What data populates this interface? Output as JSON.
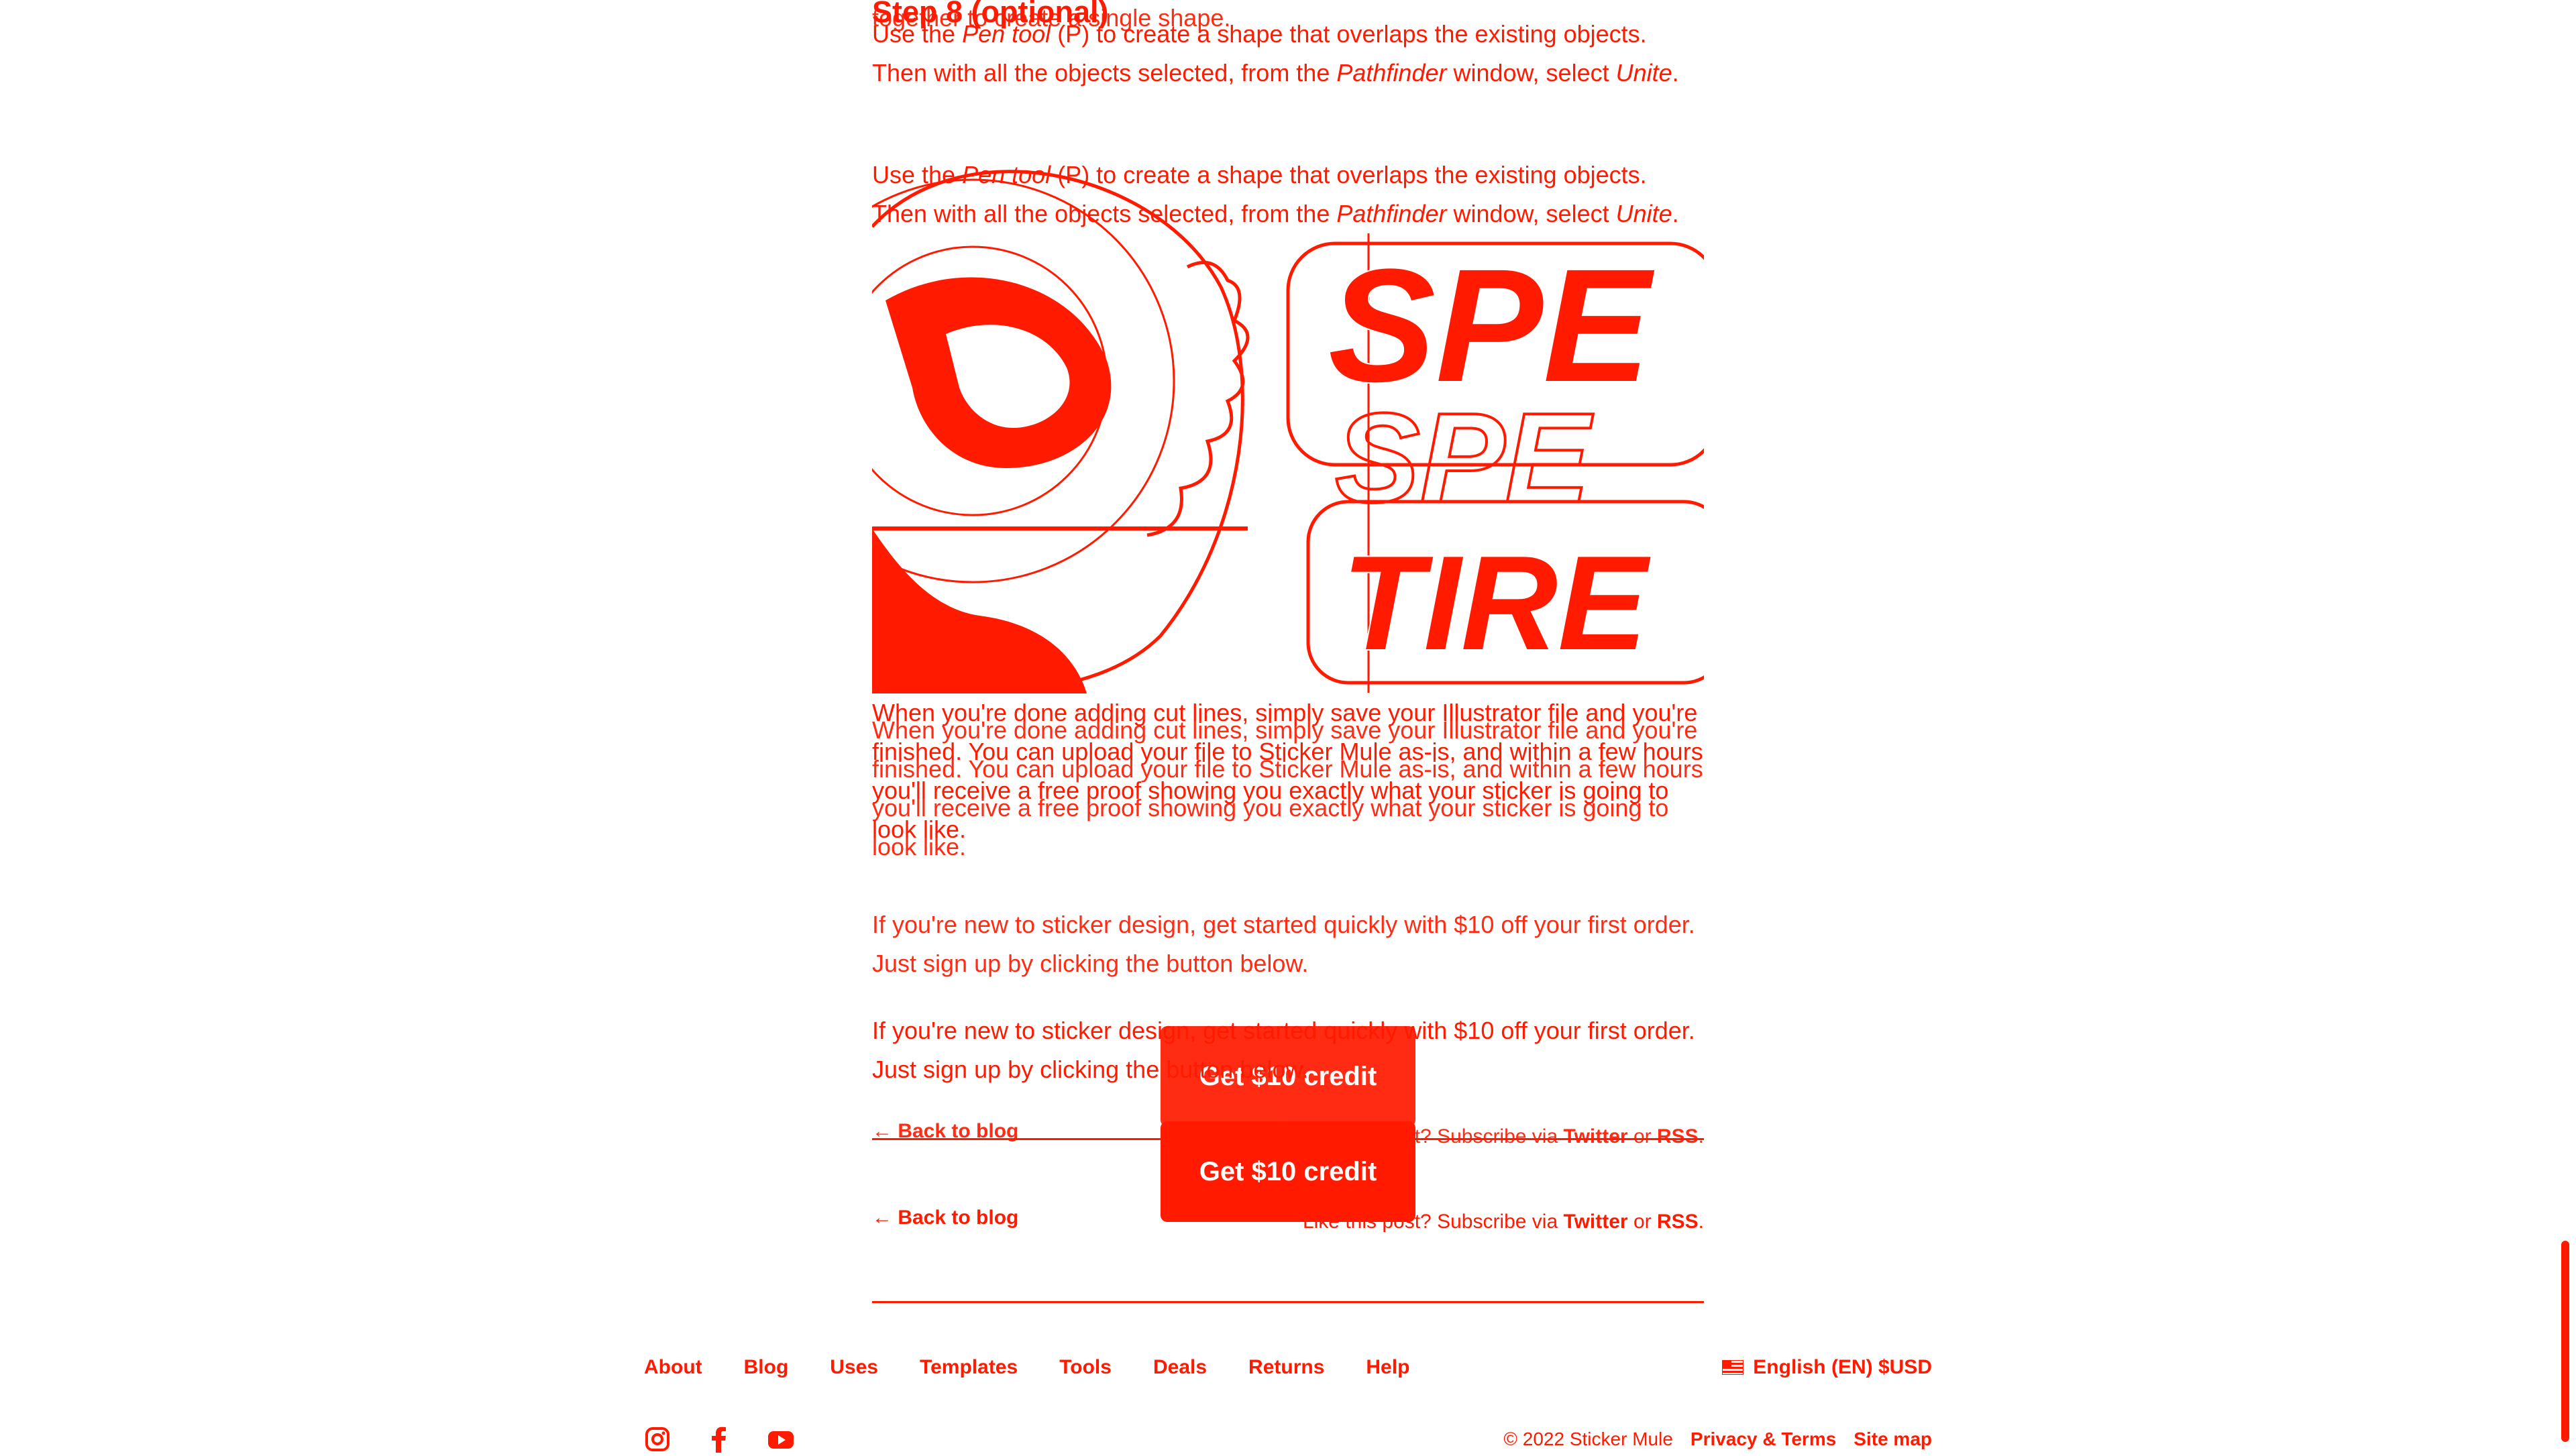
{
  "article": {
    "step_heading": "Step 8 (optional)",
    "pen_para": {
      "a": "Use the ",
      "pen_tool": "Pen tool",
      "b": " (P) to create a shape that overlaps the existing objects. Then with all the objects selected, from the ",
      "pathfinder": "Pathfinder",
      "c": " window, select ",
      "unite": "Unite",
      "d": "."
    },
    "ghost_para": "If you end up with two or more cut line objects, you'll need to bridge them together to create a single shape.",
    "done_para": "When you're done adding cut lines, simply save your Illustrator file and you're finished. You can upload your file to Sticker Mule as-is, and within a few hours you'll receive a free proof showing you exactly what your sticker is going to look like.",
    "signup_para": "If you're new to sticker design, get started quickly with $10 off your first order. Just sign up by clicking the button below.",
    "cta_label": "Get $10 credit",
    "sticker_words": [
      "SPE",
      "SPE",
      "TIRE"
    ]
  },
  "post_footer": {
    "back_link": "← Back to blog",
    "subscribe_prefix": "Like this post? Subscribe via ",
    "twitter": "Twitter",
    "or": " or ",
    "rss": "RSS",
    "period": "."
  },
  "site_footer": {
    "nav": [
      "About",
      "Blog",
      "Uses",
      "Templates",
      "Tools",
      "Deals",
      "Returns",
      "Help"
    ],
    "locale": "English (EN) $USD",
    "copyright": "© 2022 Sticker Mule",
    "privacy": "Privacy & Terms",
    "sitemap": "Site map",
    "social_icons": [
      "instagram-icon",
      "facebook-icon",
      "youtube-icon"
    ]
  },
  "colors": {
    "accent": "#ff1a00",
    "background": "#ffffff",
    "button_text": "#ffffff"
  }
}
